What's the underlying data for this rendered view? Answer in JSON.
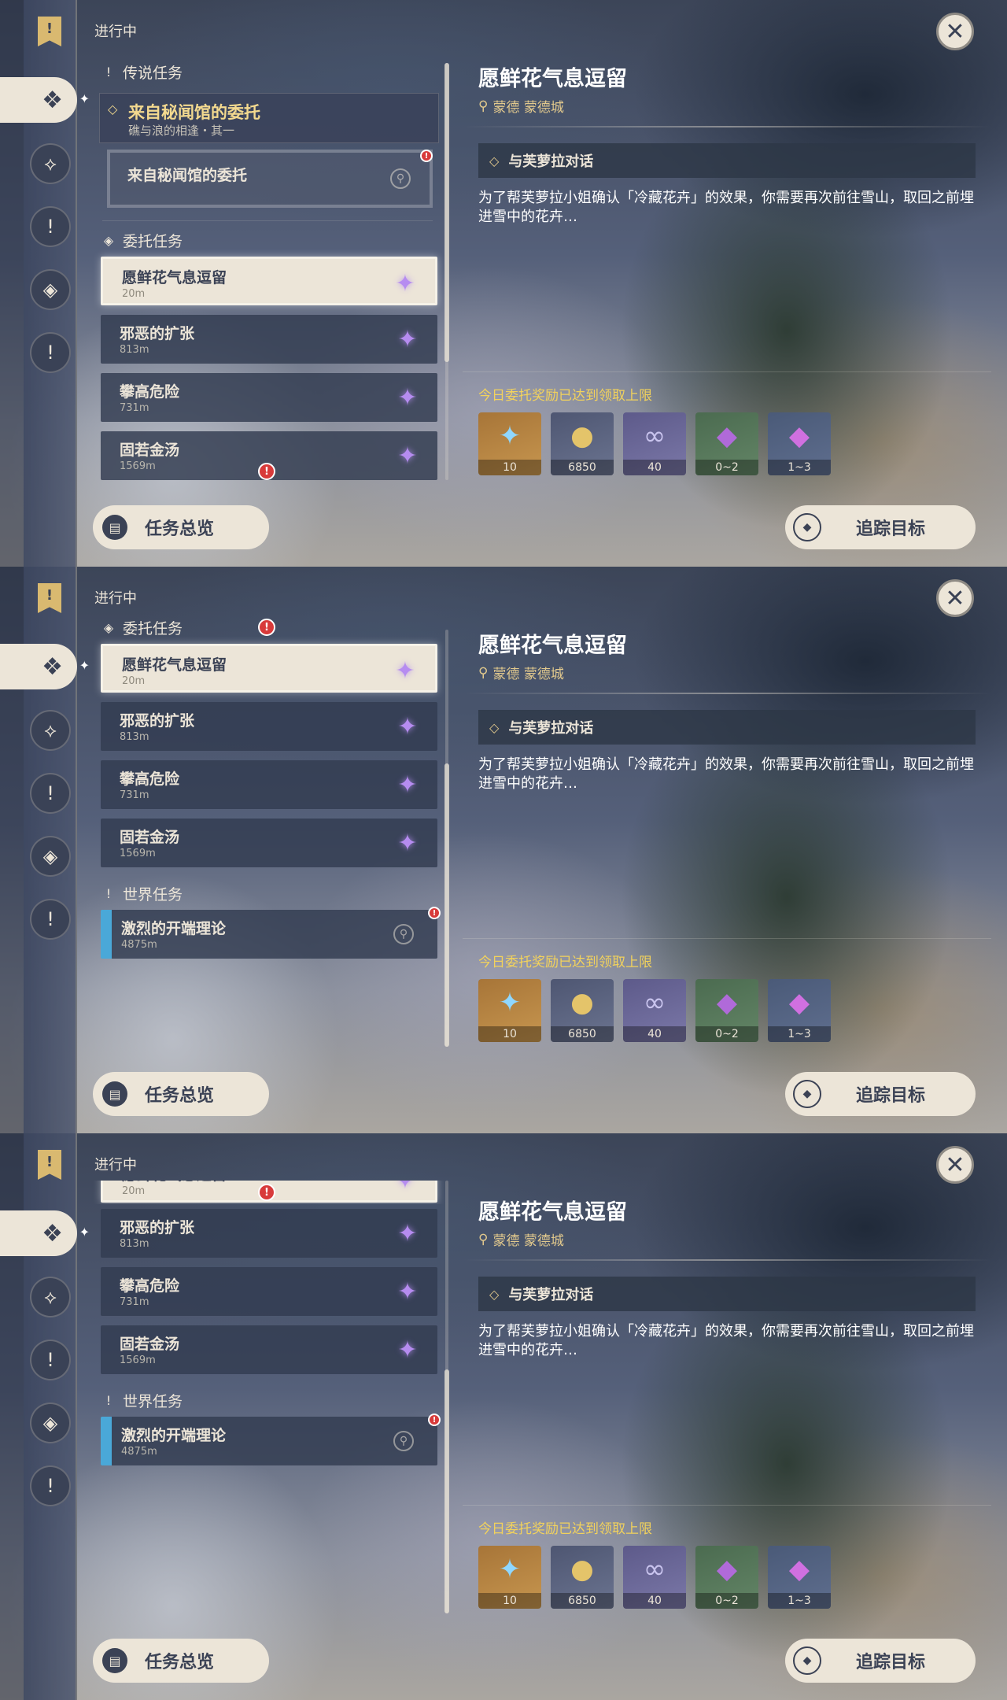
{
  "header": {
    "section_title": "进行中",
    "close_icon": "✕"
  },
  "groups": {
    "legend": "传说任务",
    "commission": "委托任务",
    "world": "世界任务"
  },
  "legend_quest": {
    "title": "来自秘闻馆的委托",
    "subtitle": "礁与浪的相逢・其一",
    "sub_item": "来自秘闻馆的委托"
  },
  "quests": [
    {
      "name": "愿鲜花气息逗留",
      "distance": "20m"
    },
    {
      "name": "邪恶的扩张",
      "distance": "813m"
    },
    {
      "name": "攀高危险",
      "distance": "731m"
    },
    {
      "name": "固若金汤",
      "distance": "1569m"
    }
  ],
  "world_quest": {
    "name": "激烈的开端理论",
    "distance": "4875m"
  },
  "detail": {
    "title": "愿鲜花气息逗留",
    "location": "蒙德 蒙德城",
    "objective": "与芙萝拉对话",
    "description": "为了帮芙萝拉小姐确认「冷藏花卉」的效果，你需要再次前往雪山，取回之前埋进雪中的花卉…",
    "reward_note": "今日委托奖励已达到领取上限",
    "rewards": [
      {
        "icon": "✦",
        "qty": "10"
      },
      {
        "icon": "●",
        "qty": "6850"
      },
      {
        "icon": "∞",
        "qty": "40"
      },
      {
        "icon": "◆",
        "qty": "0~2"
      },
      {
        "icon": "◆",
        "qty": "1~3"
      }
    ]
  },
  "buttons": {
    "overview": "任务总览",
    "track": "追踪目标"
  },
  "colors": {
    "accent_cream": "#ece5d8",
    "gold_text": "#e2c98d",
    "warning_yellow": "#f2d25c",
    "alert_red": "#d83a3a",
    "world_blue": "#4aa8d8"
  }
}
